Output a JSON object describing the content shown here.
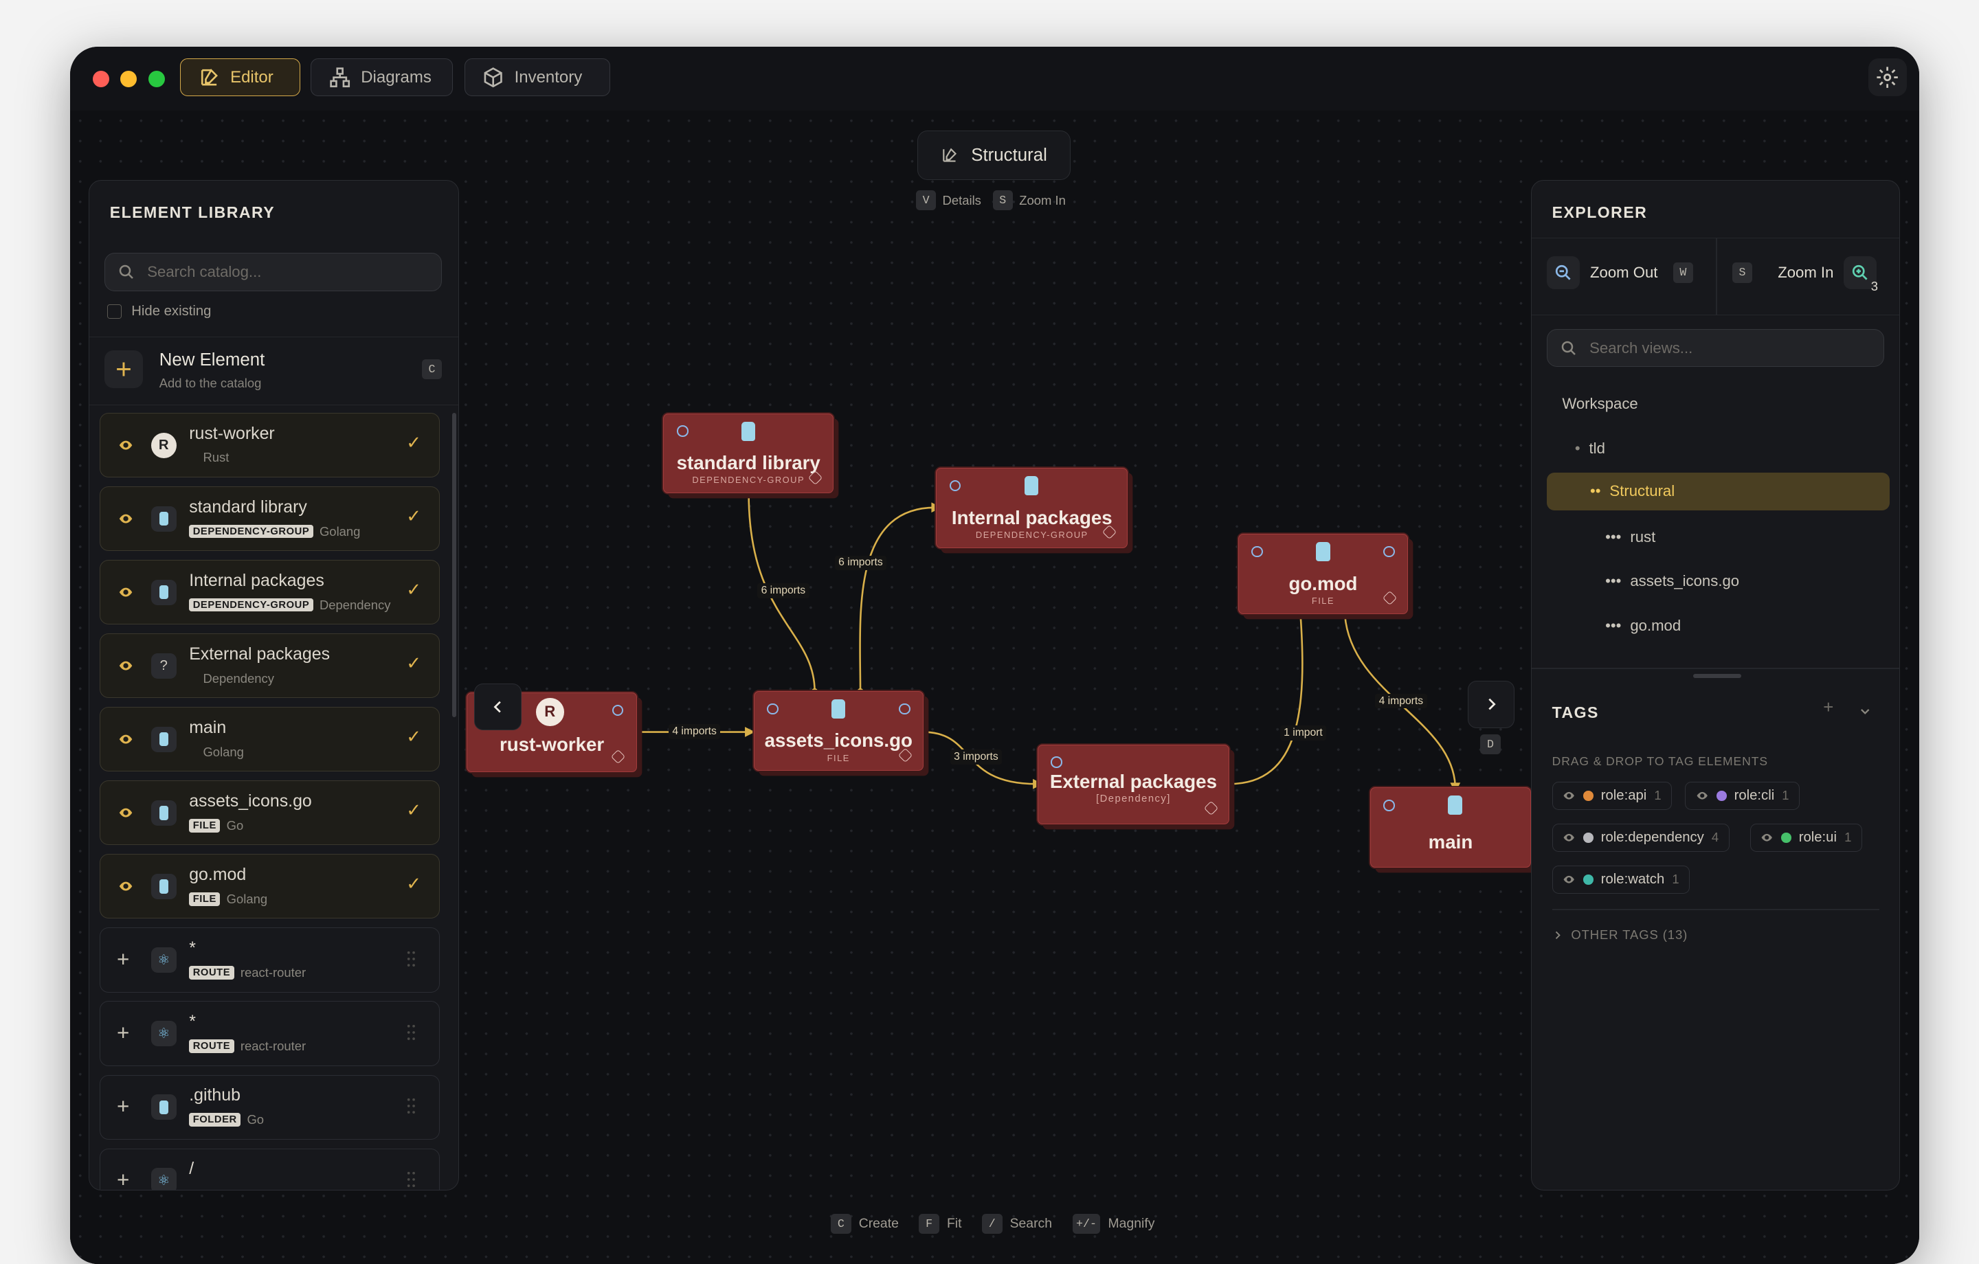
{
  "tabs": [
    {
      "label": "Editor"
    },
    {
      "label": "Diagrams"
    },
    {
      "label": "Inventory"
    }
  ],
  "view": {
    "title": "Structural",
    "hint_details_key": "V",
    "hint_details": "Details",
    "hint_zoom_key": "S",
    "hint_zoom": "Zoom In"
  },
  "library": {
    "title": "ELEMENT LIBRARY",
    "search_placeholder": "Search catalog...",
    "hide_existing": "Hide existing",
    "new_element": "New Element",
    "new_element_sub": "Add to the catalog",
    "new_element_key": "C",
    "items": [
      {
        "name": "rust-worker",
        "badge": "",
        "tech": "Rust",
        "added": true,
        "icon": "R"
      },
      {
        "name": "standard library",
        "badge": "DEPENDENCY-GROUP",
        "tech": "Golang",
        "added": true,
        "icon": "jar"
      },
      {
        "name": "Internal packages",
        "badge": "DEPENDENCY-GROUP",
        "tech": "Dependency",
        "added": true,
        "icon": "jar"
      },
      {
        "name": "External packages",
        "badge": "",
        "tech": "Dependency",
        "added": true,
        "icon": "?"
      },
      {
        "name": "main",
        "badge": "",
        "tech": "Golang",
        "added": true,
        "icon": "jar"
      },
      {
        "name": "assets_icons.go",
        "badge": "FILE",
        "tech": "Go",
        "added": true,
        "icon": "jar"
      },
      {
        "name": "go.mod",
        "badge": "FILE",
        "tech": "Golang",
        "added": true,
        "icon": "jar"
      },
      {
        "name": "*",
        "badge": "ROUTE",
        "tech": "react-router",
        "added": false,
        "icon": "react"
      },
      {
        "name": "*",
        "badge": "ROUTE",
        "tech": "react-router",
        "added": false,
        "icon": "react"
      },
      {
        "name": ".github",
        "badge": "FOLDER",
        "tech": "Go",
        "added": false,
        "icon": "jar"
      },
      {
        "name": "/",
        "badge": "",
        "tech": "",
        "added": false,
        "icon": "react"
      }
    ]
  },
  "nodes": {
    "standard_library": {
      "title": "standard library",
      "sub": "DEPENDENCY-GROUP"
    },
    "internal_packages": {
      "title": "Internal packages",
      "sub": "DEPENDENCY-GROUP"
    },
    "go_mod": {
      "title": "go.mod",
      "sub": "FILE"
    },
    "rust_worker": {
      "title": "rust-worker",
      "sub": ""
    },
    "assets_icons": {
      "title": "assets_icons.go",
      "sub": "FILE"
    },
    "external_packages": {
      "title": "External packages",
      "sub": "[Dependency]"
    },
    "main": {
      "title": "main",
      "sub": ""
    }
  },
  "edges": [
    {
      "label": "4 imports"
    },
    {
      "label": "6 imports"
    },
    {
      "label": "6 imports"
    },
    {
      "label": "3 imports"
    },
    {
      "label": "1 import"
    },
    {
      "label": "4 imports"
    }
  ],
  "nav": {
    "right_key": "D"
  },
  "explorer": {
    "title": "EXPLORER",
    "zoom_out": "Zoom Out",
    "zoom_out_key": "W",
    "zoom_in": "Zoom In",
    "zoom_in_key": "S",
    "zoom_in_count": "3",
    "search_placeholder": "Search views...",
    "tree": [
      {
        "label": "Workspace"
      },
      {
        "label": "tld"
      },
      {
        "label": "Structural"
      },
      {
        "label": "rust"
      },
      {
        "label": "assets_icons.go"
      },
      {
        "label": "go.mod"
      }
    ]
  },
  "tags": {
    "title": "TAGS",
    "hint": "DRAG & DROP TO TAG ELEMENTS",
    "items": [
      {
        "name": "role:api",
        "count": "1",
        "color": "#e08a3a"
      },
      {
        "name": "role:cli",
        "count": "1",
        "color": "#9b7be0"
      },
      {
        "name": "role:dependency",
        "count": "4",
        "color": "#b8b8bc"
      },
      {
        "name": "role:ui",
        "count": "1",
        "color": "#46c06a"
      },
      {
        "name": "role:watch",
        "count": "1",
        "color": "#3fb8a8"
      }
    ],
    "other": "OTHER TAGS (13)"
  },
  "shortcuts": [
    {
      "key": "C",
      "label": "Create"
    },
    {
      "key": "F",
      "label": "Fit"
    },
    {
      "key": "/",
      "label": "Search"
    },
    {
      "key": "+/-",
      "label": "Magnify"
    }
  ]
}
